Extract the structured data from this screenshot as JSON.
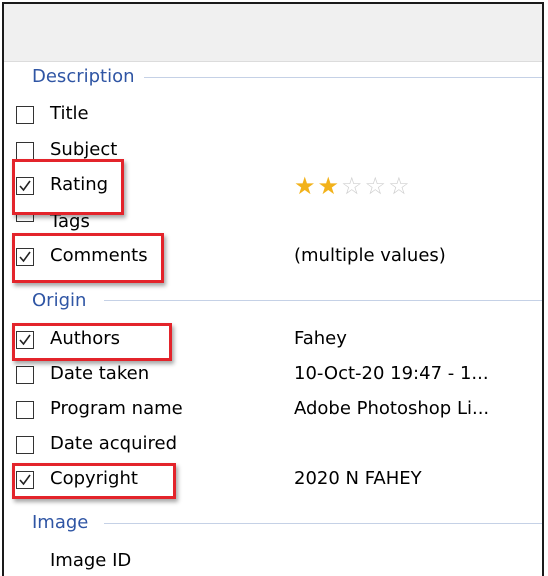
{
  "groups": {
    "description": "Description",
    "origin": "Origin",
    "image": "Image"
  },
  "rows": {
    "title": {
      "label": "Title",
      "checked": false
    },
    "subject": {
      "label": "Subject",
      "checked": false
    },
    "rating": {
      "label": "Rating",
      "checked": true,
      "stars_filled": 2,
      "stars_total": 5
    },
    "tags": {
      "label": "Tags",
      "checked": false
    },
    "comments": {
      "label": "Comments",
      "value": "(multiple values)",
      "checked": true
    },
    "authors": {
      "label": "Authors",
      "value": "Fahey",
      "checked": true
    },
    "date_taken": {
      "label": "Date taken",
      "value": "10-Oct-20 19:47 - 1...",
      "checked": false
    },
    "program_name": {
      "label": "Program name",
      "value": "Adobe Photoshop Li...",
      "checked": false
    },
    "date_acquired": {
      "label": "Date acquired",
      "checked": false
    },
    "copyright": {
      "label": "Copyright",
      "value": "2020 N FAHEY",
      "checked": true
    },
    "image_id": {
      "label": "Image ID"
    }
  },
  "colors": {
    "group_header": "#2f55a4",
    "highlight": "#e3242b",
    "star_filled": "#f2b21b",
    "star_empty": "#cfcfcf"
  }
}
